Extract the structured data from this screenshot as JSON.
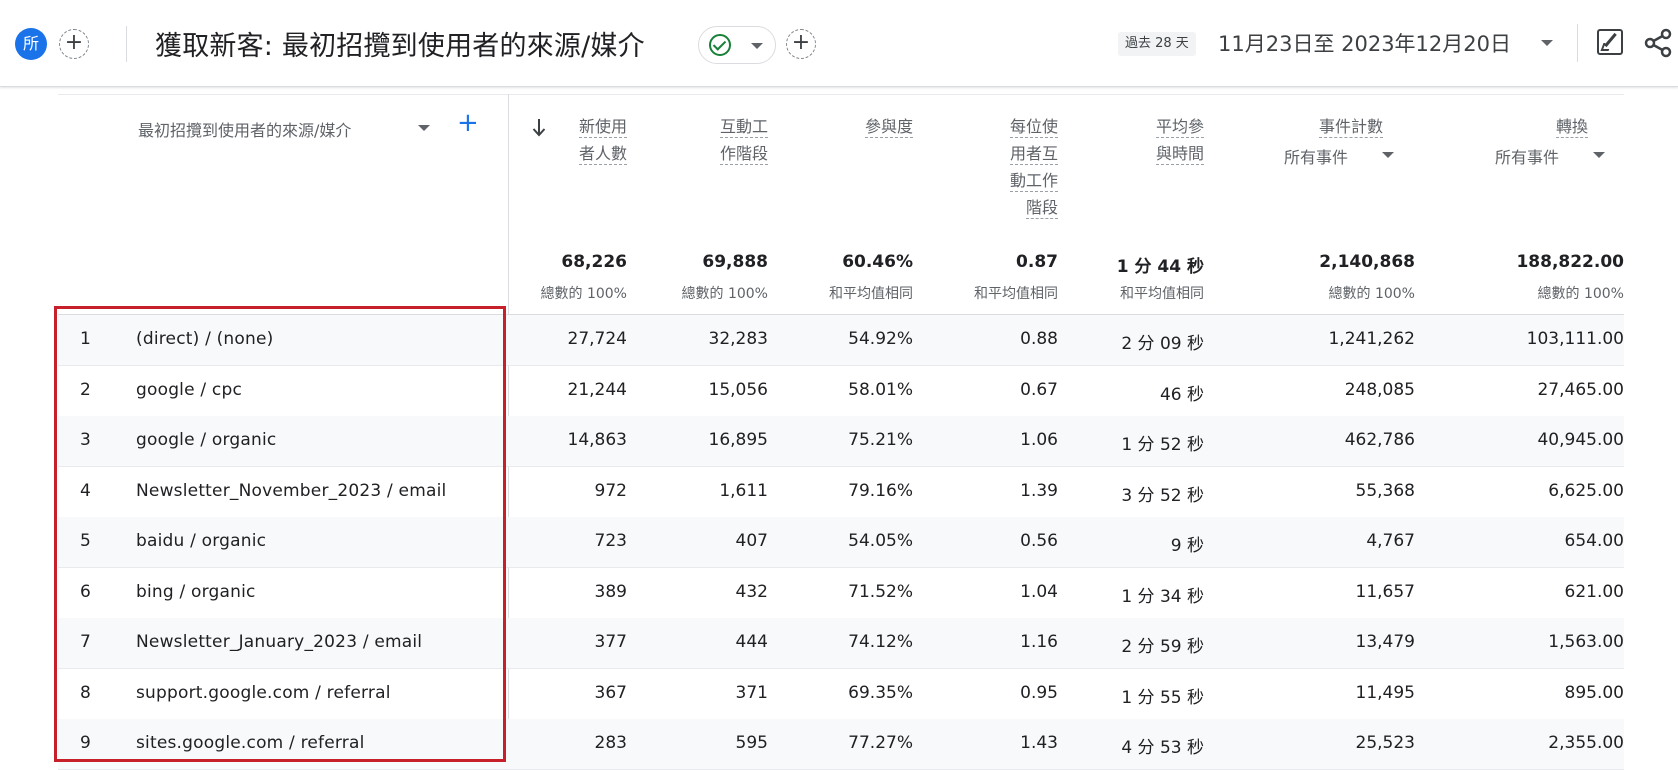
{
  "topbar": {
    "avatar_label": "所",
    "add_comparison_label": "+",
    "title": "獲取新客: 最初招攬到使用者的來源/媒介",
    "add_report_label": "+",
    "date_badge": "過去 28 天",
    "date_range": "11月23日至 2023年12月20日"
  },
  "table": {
    "dimension_header": "最初招攬到使用者的來源/媒介",
    "add_dimension_label": "+",
    "columns": [
      {
        "line1": "新使用",
        "line2": "者人數",
        "line3": "",
        "line4": "",
        "sub": "",
        "total": "68,226",
        "total_sub": "總數的 100%"
      },
      {
        "line1": "互動工",
        "line2": "作階段",
        "line3": "",
        "line4": "",
        "sub": "",
        "total": "69,888",
        "total_sub": "總數的 100%"
      },
      {
        "line1": "參與度",
        "line2": "",
        "line3": "",
        "line4": "",
        "sub": "",
        "total": "60.46%",
        "total_sub": "和平均值相同"
      },
      {
        "line1": "每位使",
        "line2": "用者互",
        "line3": "動工作",
        "line4": "階段",
        "sub": "",
        "total": "0.87",
        "total_sub": "和平均值相同"
      },
      {
        "line1": "平均參",
        "line2": "與時間",
        "line3": "",
        "line4": "",
        "sub": "",
        "total": "1 分 44 秒",
        "total_sub": "和平均值相同"
      },
      {
        "line1": "事件計數",
        "line2": "",
        "line3": "",
        "line4": "",
        "sub": "所有事件",
        "total": "2,140,868",
        "total_sub": "總數的 100%"
      },
      {
        "line1": "轉換",
        "line2": "",
        "line3": "",
        "line4": "",
        "sub": "所有事件",
        "total": "188,822.00",
        "total_sub": "總數的 100%"
      }
    ],
    "rows": [
      {
        "idx": "1",
        "dim": "(direct) / (none)",
        "v": [
          "27,724",
          "32,283",
          "54.92%",
          "0.88",
          "2 分 09 秒",
          "1,241,262",
          "103,111.00"
        ]
      },
      {
        "idx": "2",
        "dim": "google / cpc",
        "v": [
          "21,244",
          "15,056",
          "58.01%",
          "0.67",
          "46 秒",
          "248,085",
          "27,465.00"
        ]
      },
      {
        "idx": "3",
        "dim": "google / organic",
        "v": [
          "14,863",
          "16,895",
          "75.21%",
          "1.06",
          "1 分 52 秒",
          "462,786",
          "40,945.00"
        ]
      },
      {
        "idx": "4",
        "dim": "Newsletter_November_2023 / email",
        "v": [
          "972",
          "1,611",
          "79.16%",
          "1.39",
          "3 分 52 秒",
          "55,368",
          "6,625.00"
        ]
      },
      {
        "idx": "5",
        "dim": "baidu / organic",
        "v": [
          "723",
          "407",
          "54.05%",
          "0.56",
          "9 秒",
          "4,767",
          "654.00"
        ]
      },
      {
        "idx": "6",
        "dim": "bing / organic",
        "v": [
          "389",
          "432",
          "71.52%",
          "1.04",
          "1 分 34 秒",
          "11,657",
          "621.00"
        ]
      },
      {
        "idx": "7",
        "dim": "Newsletter_January_2023 / email",
        "v": [
          "377",
          "444",
          "74.12%",
          "1.16",
          "2 分 59 秒",
          "13,479",
          "1,563.00"
        ]
      },
      {
        "idx": "8",
        "dim": "support.google.com / referral",
        "v": [
          "367",
          "371",
          "69.35%",
          "0.95",
          "1 分 55 秒",
          "11,495",
          "895.00"
        ]
      },
      {
        "idx": "9",
        "dim": "sites.google.com / referral",
        "v": [
          "283",
          "595",
          "77.27%",
          "1.43",
          "4 分 53 秒",
          "25,523",
          "2,355.00"
        ]
      }
    ]
  },
  "colors": {
    "accent": "#1a73e8",
    "highlight_border": "#c8202a",
    "check": "#188038"
  }
}
